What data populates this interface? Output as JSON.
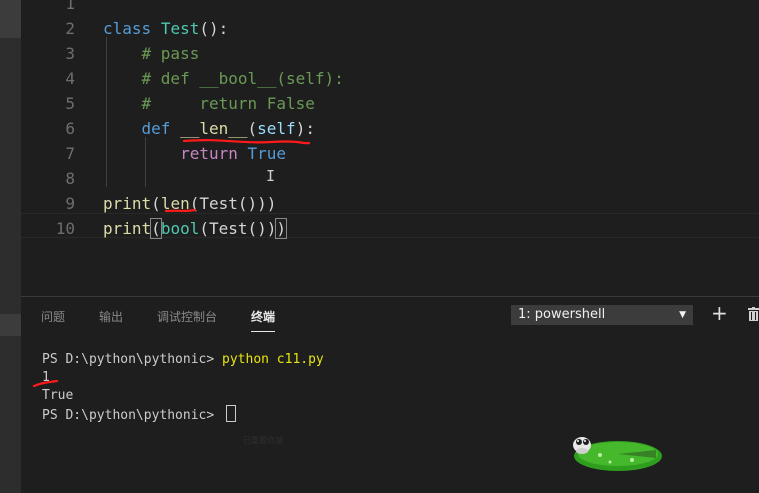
{
  "editor": {
    "lines": [
      {
        "num": "1"
      },
      {
        "num": "2",
        "tokens": [
          "class",
          "Test",
          "():"
        ]
      },
      {
        "num": "3",
        "text": "    # pass"
      },
      {
        "num": "4",
        "text": "    # def __bool__(self):"
      },
      {
        "num": "5",
        "text": "    #     return False"
      },
      {
        "num": "6",
        "tokens": [
          "    ",
          "def",
          "__len__",
          "(",
          "self",
          "):"
        ]
      },
      {
        "num": "7",
        "tokens": [
          "        ",
          "return",
          "True"
        ]
      },
      {
        "num": "8"
      },
      {
        "num": "9",
        "tokens": [
          "print",
          "(",
          "len",
          "(Test()))"
        ]
      },
      {
        "num": "10",
        "tokens": [
          "print",
          "(",
          "bool",
          "(Test())",
          ")"
        ]
      }
    ]
  },
  "panel": {
    "tabs": [
      {
        "label": "问题"
      },
      {
        "label": "输出"
      },
      {
        "label": "调试控制台"
      },
      {
        "label": "终端"
      }
    ],
    "terminal_selector": "1: powershell",
    "terminal_lines": [
      {
        "prompt": "PS D:\\python\\pythonic> ",
        "command": "python c11.py"
      },
      {
        "text": "1"
      },
      {
        "text": "True"
      },
      {
        "prompt": "PS D:\\python\\pythonic> "
      }
    ],
    "ghost_text": "已重置终端"
  },
  "theme": {
    "background": "#1e1e1e",
    "keyword": "#569cd6",
    "class_name": "#4ec9b0",
    "comment": "#6a9955",
    "control": "#c586c0",
    "function": "#dcdcaa",
    "annotation": "#ff1a1a",
    "terminal_command": "#e5e510"
  },
  "icons": [
    "plus-icon",
    "trash-icon",
    "chevron-down-icon",
    "frog-on-lily-pad-icon"
  ]
}
